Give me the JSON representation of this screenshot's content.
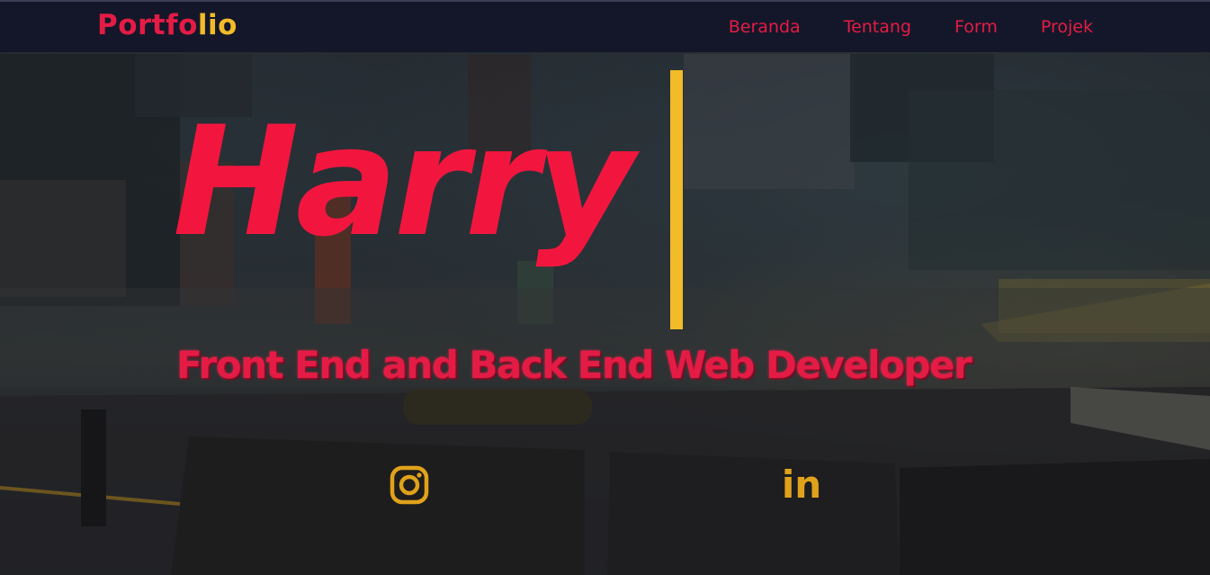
{
  "brand": {
    "part1": "Portfo",
    "part2": "lio"
  },
  "nav": {
    "items": [
      {
        "label": "Beranda"
      },
      {
        "label": "Tentang"
      },
      {
        "label": "Form"
      },
      {
        "label": "Projek"
      }
    ]
  },
  "hero": {
    "name": "Harry",
    "tagline": "Front End and Back End Web Developer"
  },
  "social": {
    "instagram_icon": "instagram-icon",
    "linkedin_icon": "linkedin-icon",
    "linkedin_text": "in"
  },
  "colors": {
    "accent_red": "#e41c45",
    "accent_yellow": "#f2bb29",
    "navbar_bg": "#141729"
  }
}
